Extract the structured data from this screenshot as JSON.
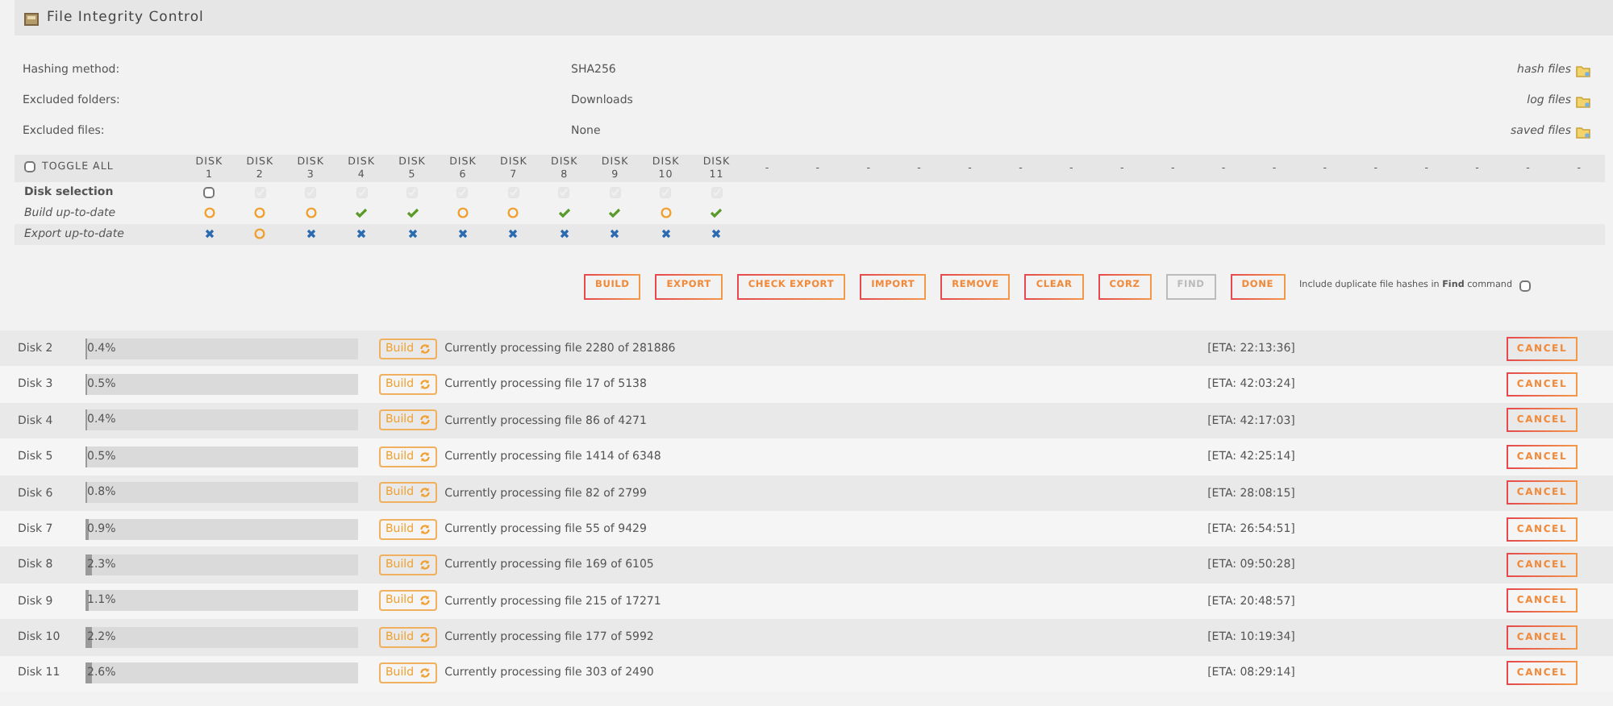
{
  "window": {
    "title": "File Integrity Control"
  },
  "settings": [
    {
      "label": "Hashing method:",
      "value": "SHA256",
      "link": "hash files"
    },
    {
      "label": "Excluded folders:",
      "value": "Downloads",
      "link": "log files"
    },
    {
      "label": "Excluded files:",
      "value": "None",
      "link": "saved files"
    }
  ],
  "disk_table": {
    "toggle_all": {
      "label": "TOGGLE ALL",
      "checked": false
    },
    "row_labels": [
      "Disk selection",
      "Build up-to-date",
      "Export up-to-date"
    ],
    "disks": [
      {
        "header": "DISK 1",
        "checked": false,
        "disabled": false,
        "build": {
          "kind": "outdated"
        },
        "export": {
          "kind": "missing"
        }
      },
      {
        "header": "DISK 2",
        "checked": true,
        "disabled": true,
        "build": {
          "kind": "outdated"
        },
        "export": {
          "kind": "outdated"
        }
      },
      {
        "header": "DISK 3",
        "checked": true,
        "disabled": true,
        "build": {
          "kind": "outdated"
        },
        "export": {
          "kind": "missing"
        }
      },
      {
        "header": "DISK 4",
        "checked": true,
        "disabled": true,
        "build": {
          "kind": "ok"
        },
        "export": {
          "kind": "missing"
        }
      },
      {
        "header": "DISK 5",
        "checked": true,
        "disabled": true,
        "build": {
          "kind": "ok"
        },
        "export": {
          "kind": "missing"
        }
      },
      {
        "header": "DISK 6",
        "checked": true,
        "disabled": true,
        "build": {
          "kind": "outdated"
        },
        "export": {
          "kind": "missing"
        }
      },
      {
        "header": "DISK 7",
        "checked": true,
        "disabled": true,
        "build": {
          "kind": "outdated"
        },
        "export": {
          "kind": "missing"
        }
      },
      {
        "header": "DISK 8",
        "checked": true,
        "disabled": true,
        "build": {
          "kind": "ok"
        },
        "export": {
          "kind": "missing"
        }
      },
      {
        "header": "DISK 9",
        "checked": true,
        "disabled": true,
        "build": {
          "kind": "ok"
        },
        "export": {
          "kind": "missing"
        }
      },
      {
        "header": "DISK 10",
        "checked": true,
        "disabled": true,
        "build": {
          "kind": "outdated"
        },
        "export": {
          "kind": "missing"
        }
      },
      {
        "header": "DISK 11",
        "checked": true,
        "disabled": true,
        "build": {
          "kind": "ok"
        },
        "export": {
          "kind": "missing"
        }
      }
    ],
    "empty_columns": [
      "-",
      "-",
      "-",
      "-",
      "-",
      "-",
      "-",
      "-",
      "-",
      "-",
      "-",
      "-",
      "-",
      "-",
      "-",
      "-",
      "-"
    ]
  },
  "buttons": [
    {
      "label": "BUILD",
      "disabled": false
    },
    {
      "label": "EXPORT",
      "disabled": false
    },
    {
      "label": "CHECK EXPORT",
      "disabled": false
    },
    {
      "label": "IMPORT",
      "disabled": false
    },
    {
      "label": "REMOVE",
      "disabled": false
    },
    {
      "label": "CLEAR",
      "disabled": false
    },
    {
      "label": "CORZ",
      "disabled": false
    },
    {
      "label": "FIND",
      "disabled": true
    },
    {
      "label": "DONE",
      "disabled": false
    }
  ],
  "duplicate_option": {
    "label": "Include duplicate file hashes in **Find** command",
    "checked": false
  },
  "progress": [
    {
      "disk": "Disk 2",
      "percent": "0.4%",
      "level": 0.004,
      "action": "Build",
      "status": "Currently processing file 2280 of 281886",
      "eta": "[ETA: 22:13:36]",
      "cancel": "CANCEL"
    },
    {
      "disk": "Disk 3",
      "percent": "0.5%",
      "level": 0.005,
      "action": "Build",
      "status": "Currently processing file 17 of 5138",
      "eta": "[ETA: 42:03:24]",
      "cancel": "CANCEL"
    },
    {
      "disk": "Disk 4",
      "percent": "0.4%",
      "level": 0.004,
      "action": "Build",
      "status": "Currently processing file 86 of 4271",
      "eta": "[ETA: 42:17:03]",
      "cancel": "CANCEL"
    },
    {
      "disk": "Disk 5",
      "percent": "0.5%",
      "level": 0.005,
      "action": "Build",
      "status": "Currently processing file 1414 of 6348",
      "eta": "[ETA: 42:25:14]",
      "cancel": "CANCEL"
    },
    {
      "disk": "Disk 6",
      "percent": "0.8%",
      "level": 0.008,
      "action": "Build",
      "status": "Currently processing file 82 of 2799",
      "eta": "[ETA: 28:08:15]",
      "cancel": "CANCEL"
    },
    {
      "disk": "Disk 7",
      "percent": "0.9%",
      "level": 0.009,
      "action": "Build",
      "status": "Currently processing file 55 of 9429",
      "eta": "[ETA: 26:54:51]",
      "cancel": "CANCEL"
    },
    {
      "disk": "Disk 8",
      "percent": "2.3%",
      "level": 0.023,
      "action": "Build",
      "status": "Currently processing file 169 of 6105",
      "eta": "[ETA: 09:50:28]",
      "cancel": "CANCEL"
    },
    {
      "disk": "Disk 9",
      "percent": "1.1%",
      "level": 0.011,
      "action": "Build",
      "status": "Currently processing file 215 of 17271",
      "eta": "[ETA: 20:48:57]",
      "cancel": "CANCEL"
    },
    {
      "disk": "Disk 10",
      "percent": "2.2%",
      "level": 0.022,
      "action": "Build",
      "status": "Currently processing file 177 of 5992",
      "eta": "[ETA: 10:19:34]",
      "cancel": "CANCEL"
    },
    {
      "disk": "Disk 11",
      "percent": "2.6%",
      "level": 0.026,
      "action": "Build",
      "status": "Currently processing file 303 of 2490",
      "eta": "[ETA: 08:29:14]",
      "cancel": "CANCEL"
    }
  ]
}
